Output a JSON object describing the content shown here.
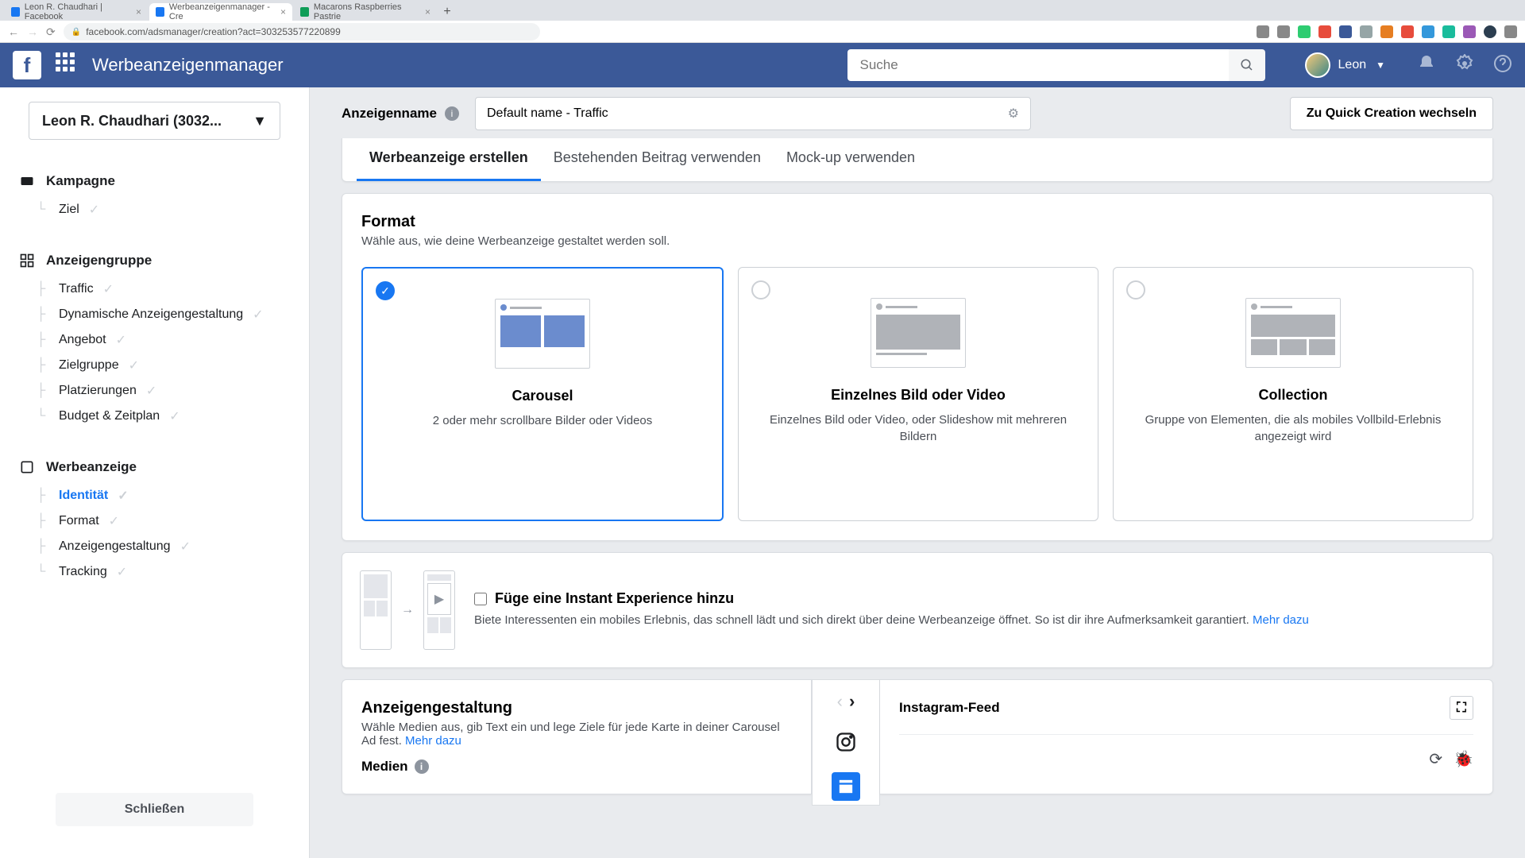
{
  "browser": {
    "tabs": [
      {
        "title": "Leon R. Chaudhari | Facebook",
        "favicon": "#1877f2"
      },
      {
        "title": "Werbeanzeigenmanager - Cre",
        "favicon": "#1877f2"
      },
      {
        "title": "Macarons Raspberries Pastrie",
        "favicon": "#0f9d58"
      }
    ],
    "url": "facebook.com/adsmanager/creation?act=303253577220899"
  },
  "header": {
    "title": "Werbeanzeigenmanager",
    "search_placeholder": "Suche",
    "user": "Leon"
  },
  "account": {
    "label": "Leon R. Chaudhari (3032..."
  },
  "sidebar": {
    "campaign": {
      "label": "Kampagne",
      "items": [
        {
          "label": "Ziel"
        }
      ]
    },
    "adset": {
      "label": "Anzeigengruppe",
      "items": [
        {
          "label": "Traffic"
        },
        {
          "label": "Dynamische Anzeigengestaltung"
        },
        {
          "label": "Angebot"
        },
        {
          "label": "Zielgruppe"
        },
        {
          "label": "Platzierungen"
        },
        {
          "label": "Budget & Zeitplan"
        }
      ]
    },
    "ad": {
      "label": "Werbeanzeige",
      "items": [
        {
          "label": "Identität",
          "active": true
        },
        {
          "label": "Format"
        },
        {
          "label": "Anzeigengestaltung"
        },
        {
          "label": "Tracking"
        }
      ]
    },
    "close": "Schließen"
  },
  "main": {
    "ad_name_label": "Anzeigenname",
    "ad_name_value": "Default name - Traffic",
    "quick_creation": "Zu Quick Creation wechseln",
    "tabs": [
      {
        "label": "Werbeanzeige erstellen",
        "active": true
      },
      {
        "label": "Bestehenden Beitrag verwenden"
      },
      {
        "label": "Mock-up verwenden"
      }
    ],
    "format": {
      "title": "Format",
      "subtitle": "Wähle aus, wie deine Werbeanzeige gestaltet werden soll.",
      "options": [
        {
          "title": "Carousel",
          "desc": "2 oder mehr scrollbare Bilder oder Videos",
          "selected": true
        },
        {
          "title": "Einzelnes Bild oder Video",
          "desc": "Einzelnes Bild oder Video, oder Slideshow mit mehreren Bildern"
        },
        {
          "title": "Collection",
          "desc": "Gruppe von Elementen, die als mobiles Vollbild-Erlebnis angezeigt wird"
        }
      ]
    },
    "instant": {
      "title": "Füge eine Instant Experience hinzu",
      "desc": "Biete Interessenten ein mobiles Erlebnis, das schnell lädt und sich direkt über deine Werbeanzeige öffnet. So ist dir ihre Aufmerksamkeit garantiert. ",
      "link": "Mehr dazu"
    },
    "design": {
      "title": "Anzeigengestaltung",
      "subtitle": "Wähle Medien aus, gib Text ein und lege Ziele für jede Karte in deiner Carousel Ad fest. ",
      "link": "Mehr dazu",
      "media_label": "Medien"
    },
    "preview": {
      "title": "Instagram-Feed"
    }
  }
}
